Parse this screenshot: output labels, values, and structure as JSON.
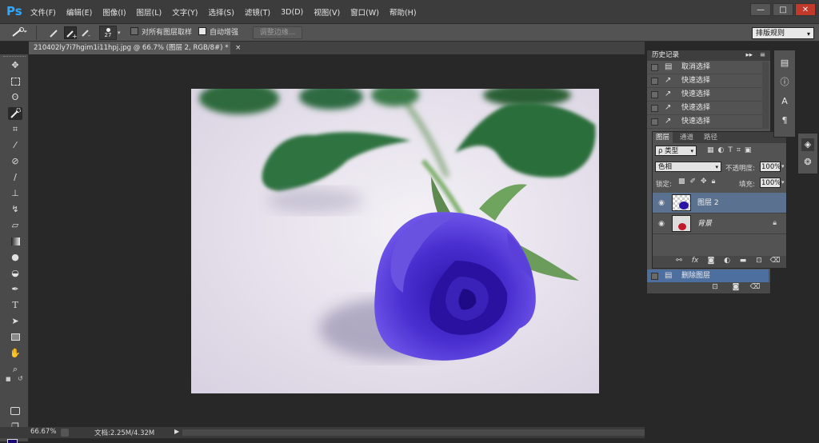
{
  "app": {
    "logo": "Ps"
  },
  "menu": {
    "items": [
      "文件(F)",
      "编辑(E)",
      "图像(I)",
      "图层(L)",
      "文字(Y)",
      "选择(S)",
      "滤镜(T)",
      "3D(D)",
      "视图(V)",
      "窗口(W)",
      "帮助(H)"
    ]
  },
  "window_controls": {
    "minimize": "—",
    "restore": "□",
    "close": "✕"
  },
  "options_bar": {
    "brush_size": "27",
    "sample_all_layers": {
      "label": "对所有图层取样",
      "checked": false
    },
    "auto_enhance": {
      "label": "自动增强",
      "checked": true
    },
    "refine_edge": "调整边缘...",
    "workspace": "排版规则"
  },
  "document_tab": {
    "title": "210402ly7i7hgim1i11hpj.jpg @ 66.7% (图层 2, RGB/8#) *",
    "close": "×"
  },
  "status_bar": {
    "zoom": "66.67%",
    "doc_info": "文档:2.25M/4.32M"
  },
  "colors": {
    "foreground": "#1a0a6e",
    "background": "#000000",
    "accent": "#31a8ff"
  },
  "history_panel": {
    "title": "历史记录",
    "items": [
      {
        "icon": "document-icon",
        "label": "取消选择"
      },
      {
        "icon": "quick-select-icon",
        "label": "快速选择"
      },
      {
        "icon": "quick-select-icon",
        "label": "快速选择"
      },
      {
        "icon": "quick-select-icon",
        "label": "快速选择"
      },
      {
        "icon": "quick-select-icon",
        "label": "快速选择"
      }
    ],
    "bottom_item": "删除图层"
  },
  "layers_panel": {
    "tabs": [
      "图层",
      "通道",
      "路径"
    ],
    "filter": "ρ 类型",
    "blend_mode": "色相",
    "opacity_label": "不透明度:",
    "opacity": "100%",
    "lock_label": "锁定:",
    "fill_label": "填充:",
    "fill": "100%",
    "layers": [
      {
        "name": "图层 2",
        "selected": true,
        "locked": false
      },
      {
        "name": "背景",
        "selected": false,
        "locked": true
      }
    ]
  }
}
